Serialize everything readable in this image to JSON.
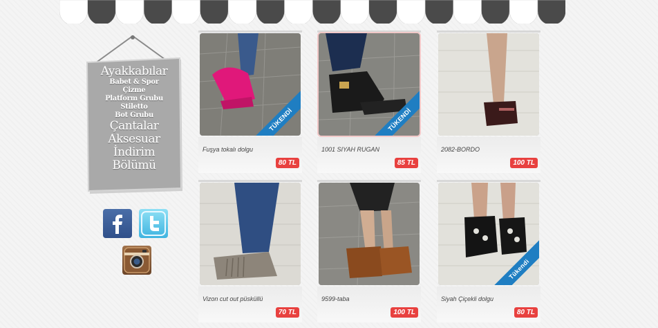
{
  "menu": {
    "items": [
      {
        "label": "Ayakkabılar",
        "size": "big"
      },
      {
        "label": "Babet & Spor",
        "size": "small"
      },
      {
        "label": "Çizme",
        "size": "small"
      },
      {
        "label": "Platform Grubu",
        "size": "small"
      },
      {
        "label": "Stiletto",
        "size": "small"
      },
      {
        "label": "Bot Grubu",
        "size": "small"
      },
      {
        "label": "Çantalar",
        "size": "big"
      },
      {
        "label": "Aksesuar",
        "size": "big"
      },
      {
        "label": "İndirim Bölümü",
        "size": "big"
      }
    ]
  },
  "social": {
    "facebook_icon": "facebook-icon",
    "twitter_icon": "twitter-icon",
    "instagram_icon": "instagram-icon"
  },
  "colors": {
    "accent_price": "#e8413f",
    "ribbon": "#1f7ec2"
  },
  "products": [
    {
      "name": "Fuşya tokalı dolgu",
      "price": "80 TL",
      "badge": "TÜKENDİ"
    },
    {
      "name": "1001 SIYAH RUGAN",
      "price": "85 TL",
      "badge": "TÜKENDİ"
    },
    {
      "name": "2082-BORDO",
      "price": "100 TL",
      "badge": ""
    },
    {
      "name": "Vizon cut out püsküllü",
      "price": "70 TL",
      "badge": ""
    },
    {
      "name": "9599-taba",
      "price": "100 TL",
      "badge": ""
    },
    {
      "name": "Siyah Çiçekli dolgu",
      "price": "80 TL",
      "badge": "Tükendi"
    }
  ]
}
